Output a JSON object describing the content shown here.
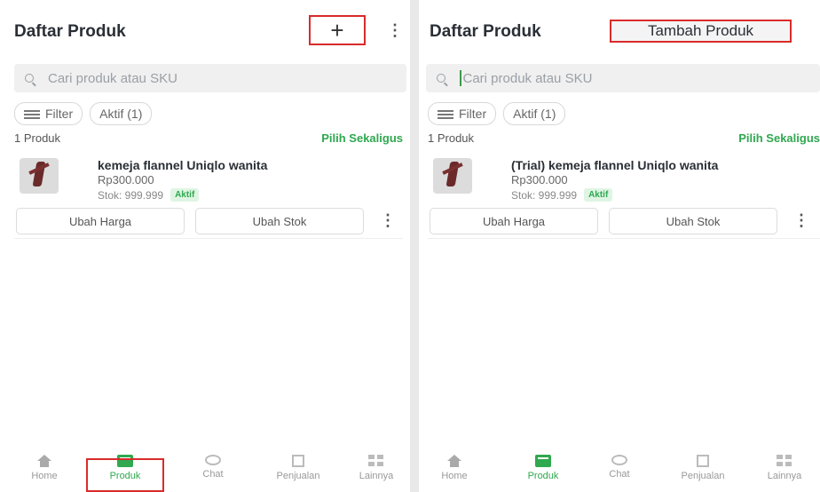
{
  "left": {
    "title": "Daftar Produk",
    "add_icon": "+",
    "menu_icon": "⋮",
    "search_placeholder": "Cari produk atau SKU",
    "filter_label": "Filter",
    "aktif_label": "Aktif (1)",
    "count": "1 Produk",
    "pilih_label": "Pilih Sekaligus",
    "product": {
      "name": "kemeja flannel Uniqlo wanita",
      "price": "Rp300.000",
      "stock_label": "Stok: 999.999",
      "status": "Aktif"
    },
    "ubah_harga": "Ubah Harga",
    "ubah_stok": "Ubah Stok",
    "more_icon": "⋮"
  },
  "right": {
    "title": "Daftar Produk",
    "tooltip": "Tambah Produk",
    "search_placeholder": "Cari produk atau SKU",
    "filter_label": "Filter",
    "aktif_label": "Aktif (1)",
    "count": "1 Produk",
    "pilih_label": "Pilih Sekaligus",
    "product": {
      "name": "(Trial) kemeja flannel Uniqlo wanita",
      "price": "Rp300.000",
      "stock_label": "Stok: 999.999",
      "status": "Aktif"
    },
    "ubah_harga": "Ubah Harga",
    "ubah_stok": "Ubah Stok",
    "more_icon": "⋮"
  },
  "nav_left": [
    "Home",
    "Produk",
    "Chat",
    "Penjualan",
    "Lainnya"
  ],
  "nav_right": [
    "Home",
    "Produk",
    "Chat",
    "Penjualan",
    "Lainnya"
  ],
  "colors": {
    "accent": "#2fa84f",
    "highlight": "#d92b2b"
  }
}
